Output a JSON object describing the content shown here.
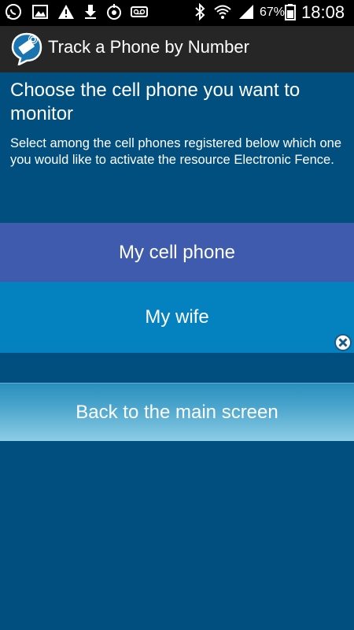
{
  "status_bar": {
    "icons": [
      "whatsapp-icon",
      "gallery-icon",
      "warning-icon",
      "download-icon",
      "sync-icon",
      "voicemail-icon",
      "bluetooth-icon",
      "wifi-icon",
      "signal-icon",
      "battery-icon"
    ],
    "battery_percent": "67%",
    "time": "18:08"
  },
  "action_bar": {
    "title": "Track a Phone by Number",
    "logo_icon": "app-logo-icon"
  },
  "main": {
    "heading": "Choose the cell phone you want to monitor",
    "description": "Select among the cell phones registered below which one you would like to activate the resource Electronic Fence.",
    "phones": [
      {
        "label": "My cell phone"
      },
      {
        "label": "My wife"
      }
    ],
    "back_label": "Back to the main screen"
  },
  "colors": {
    "background": "#004f7f",
    "option_selected": "#3f5bad",
    "option_normal": "#0481bf",
    "action_bar": "#262626"
  }
}
